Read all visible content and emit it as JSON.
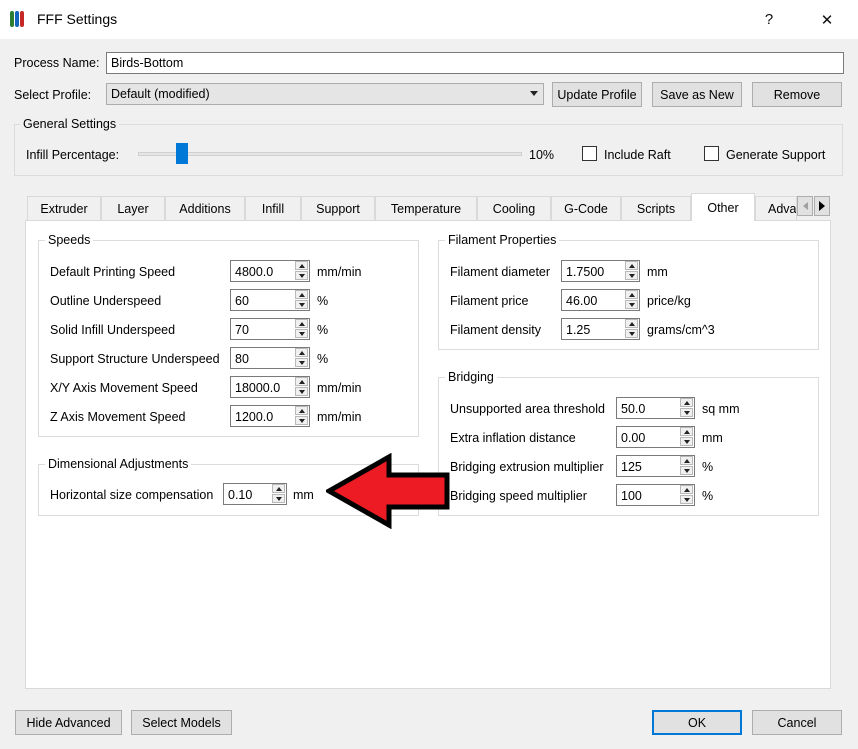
{
  "window": {
    "title": "FFF Settings",
    "help_glyph": "?",
    "close_glyph": "✕"
  },
  "process": {
    "label": "Process Name:",
    "value": "Birds-Bottom"
  },
  "profile": {
    "label": "Select Profile:",
    "value": "Default (modified)",
    "update_label": "Update Profile",
    "save_new_label": "Save as New",
    "remove_label": "Remove"
  },
  "general": {
    "title": "General Settings",
    "infill_label": "Infill Percentage:",
    "infill_value": "10%",
    "infill_fraction": 0.1,
    "raft_label": "Include Raft",
    "raft_checked": false,
    "support_label": "Generate Support",
    "support_checked": false
  },
  "tabs": [
    {
      "label": "Extruder"
    },
    {
      "label": "Layer"
    },
    {
      "label": "Additions"
    },
    {
      "label": "Infill"
    },
    {
      "label": "Support"
    },
    {
      "label": "Temperature"
    },
    {
      "label": "Cooling"
    },
    {
      "label": "G-Code"
    },
    {
      "label": "Scripts"
    },
    {
      "label": "Other"
    },
    {
      "label": "Adva"
    }
  ],
  "active_tab": "Other",
  "speeds": {
    "title": "Speeds",
    "rows": [
      {
        "label": "Default Printing Speed",
        "value": "4800.0",
        "unit": "mm/min"
      },
      {
        "label": "Outline Underspeed",
        "value": "60",
        "unit": "%"
      },
      {
        "label": "Solid Infill Underspeed",
        "value": "70",
        "unit": "%"
      },
      {
        "label": "Support Structure Underspeed",
        "value": "80",
        "unit": "%"
      },
      {
        "label": "X/Y Axis Movement Speed",
        "value": "18000.0",
        "unit": "mm/min"
      },
      {
        "label": "Z Axis Movement Speed",
        "value": "1200.0",
        "unit": "mm/min"
      }
    ]
  },
  "dimensional": {
    "title": "Dimensional Adjustments",
    "rows": [
      {
        "label": "Horizontal size compensation",
        "value": "0.10",
        "unit": "mm"
      }
    ]
  },
  "filament": {
    "title": "Filament Properties",
    "rows": [
      {
        "label": "Filament diameter",
        "value": "1.7500",
        "unit": "mm"
      },
      {
        "label": "Filament price",
        "value": "46.00",
        "unit": "price/kg"
      },
      {
        "label": "Filament density",
        "value": "1.25",
        "unit": "grams/cm^3"
      }
    ]
  },
  "bridging": {
    "title": "Bridging",
    "rows": [
      {
        "label": "Unsupported area threshold",
        "value": "50.0",
        "unit": "sq mm"
      },
      {
        "label": "Extra inflation distance",
        "value": "0.00",
        "unit": "mm"
      },
      {
        "label": "Bridging extrusion multiplier",
        "value": "125",
        "unit": "%"
      },
      {
        "label": "Bridging speed multiplier",
        "value": "100",
        "unit": "%"
      }
    ]
  },
  "footer": {
    "hide_advanced_label": "Hide Advanced",
    "select_models_label": "Select Models",
    "ok_label": "OK",
    "cancel_label": "Cancel"
  },
  "colors": {
    "accent": "#0078d7",
    "arrow": "#ed1c24"
  }
}
